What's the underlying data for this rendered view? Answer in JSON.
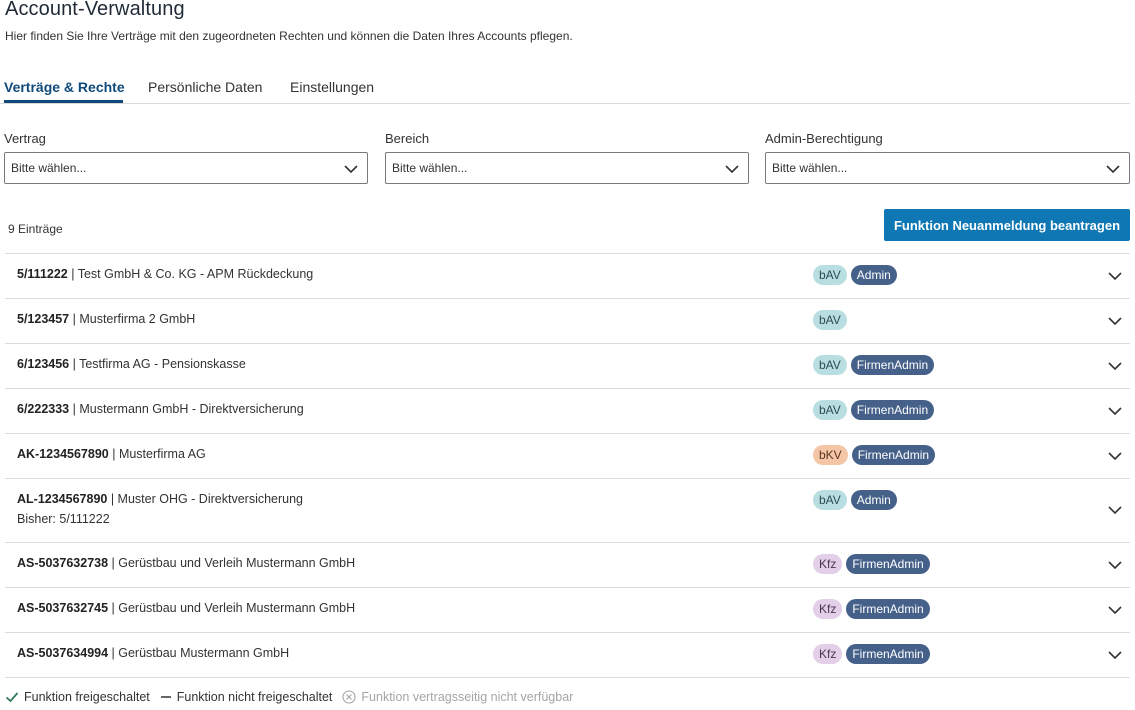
{
  "page": {
    "title": "Account-Verwaltung",
    "subtitle": "Hier finden Sie Ihre Verträge mit den zugeordneten Rechten und können die Daten Ihres Accounts pflegen."
  },
  "tabs": [
    {
      "label": "Verträge & Rechte",
      "active": true
    },
    {
      "label": "Persönliche Daten",
      "active": false
    },
    {
      "label": "Einstellungen",
      "active": false
    }
  ],
  "filters": [
    {
      "label": "Vertrag",
      "placeholder": "Bitte wählen..."
    },
    {
      "label": "Bereich",
      "placeholder": "Bitte wählen..."
    },
    {
      "label": "Admin-Berechtigung",
      "placeholder": "Bitte wählen..."
    }
  ],
  "list": {
    "count_label": "9 Einträge",
    "action_button": "Funktion Neuanmeldung beantragen",
    "rows": [
      {
        "id": "5/111222",
        "name": " | Test GmbH & Co. KG - APM Rückdeckung",
        "sub": "",
        "area": "bAV",
        "role": "Admin"
      },
      {
        "id": "5/123457",
        "name": " | Musterfirma 2 GmbH",
        "sub": "",
        "area": "bAV",
        "role": ""
      },
      {
        "id": "6/123456",
        "name": " | Testfirma AG - Pensionskasse",
        "sub": "",
        "area": "bAV",
        "role": "FirmenAdmin"
      },
      {
        "id": "6/222333",
        "name": " | Mustermann GmbH - Direktversicherung",
        "sub": "",
        "area": "bAV",
        "role": "FirmenAdmin"
      },
      {
        "id": "AK-1234567890",
        "name": " | Musterfirma AG",
        "sub": "",
        "area": "bKV",
        "role": "FirmenAdmin"
      },
      {
        "id": "AL-1234567890",
        "name": " | Muster OHG - Direktversicherung",
        "sub": "Bisher: 5/111222",
        "area": "bAV",
        "role": "Admin"
      },
      {
        "id": "AS-5037632738",
        "name": " | Gerüstbau und Verleih Mustermann GmbH",
        "sub": "",
        "area": "Kfz",
        "role": "FirmenAdmin"
      },
      {
        "id": "AS-5037632745",
        "name": " | Gerüstbau und Verleih Mustermann GmbH",
        "sub": "",
        "area": "Kfz",
        "role": "FirmenAdmin"
      },
      {
        "id": "AS-5037634994",
        "name": " | Gerüstbau Mustermann GmbH",
        "sub": "",
        "area": "Kfz",
        "role": "FirmenAdmin"
      }
    ]
  },
  "legend": [
    {
      "icon": "check-icon",
      "label": "Funktion freigeschaltet"
    },
    {
      "icon": "dash-icon",
      "label": "Funktion nicht freigeschaltet"
    },
    {
      "icon": "circle-x-icon",
      "label": "Funktion vertragsseitig nicht verfügbar"
    }
  ],
  "colors": {
    "accent": "#0f4a7a",
    "button": "#0f78b4",
    "badge_bav": "#b9dee2",
    "badge_bkv": "#f5c6a6",
    "badge_kfz": "#e3cfe8",
    "badge_role": "#45618a"
  }
}
